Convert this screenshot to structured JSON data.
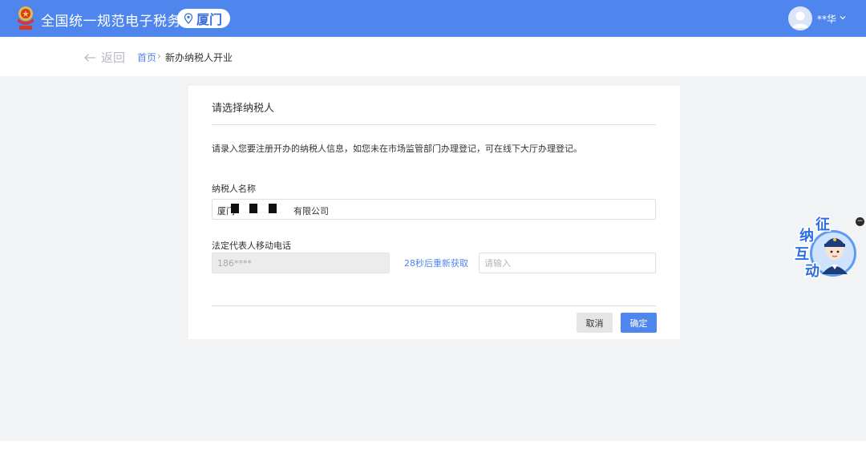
{
  "header": {
    "site_title": "全国统一规范电子税务局",
    "city": "厦门",
    "user_name": "**华",
    "icons": {
      "emblem": "national-tax-emblem-icon",
      "location": "location-pin-icon",
      "avatar": "user-avatar-icon",
      "menu": "chevron-down-icon"
    },
    "colors": {
      "bar": "#4f86ee",
      "city_text": "#3a6fd8"
    }
  },
  "breadcrumb": {
    "back_label": "返回",
    "home": "首页",
    "separator": "›",
    "current": "新办纳税人开业",
    "icons": {
      "back": "arrow-left-icon"
    }
  },
  "form": {
    "title": "请选择纳税人",
    "instruction": "请录入您要注册开办的纳税人信息，如您未在市场监管部门办理登记，可在线下大厅办理登记。",
    "taxpayer_name_label": "纳税人名称",
    "taxpayer_name_prefix": "厦门",
    "taxpayer_name_suffix": "有限公司",
    "phone_label": "法定代表人移动电话",
    "phone_value": "186****",
    "resend_label": "28秒后重新获取",
    "code_placeholder": "请输入",
    "cancel_label": "取消",
    "confirm_label": "确定",
    "colors": {
      "primary": "#4f86ee",
      "cancel_bg": "#e4e5e7",
      "disabled_bg": "#ececec"
    }
  },
  "widget": {
    "label": "征纳互动",
    "chars": [
      "征",
      "纳",
      "互",
      "动"
    ],
    "close": "−",
    "icons": {
      "mascot": "tax-officer-mascot-icon",
      "close": "close-icon"
    }
  }
}
